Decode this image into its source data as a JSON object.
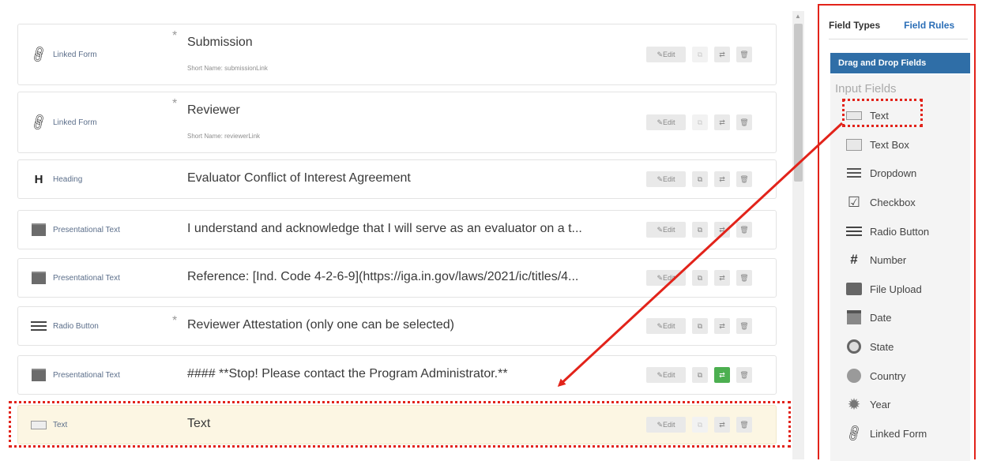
{
  "rows": [
    {
      "type_label": "Linked Form",
      "icon": "link-icon",
      "required": "*",
      "title": "Submission",
      "short_name": "Short Name: submissionLink",
      "edit": "Edit"
    },
    {
      "type_label": "Linked Form",
      "icon": "link-icon",
      "required": "*",
      "title": "Reviewer",
      "short_name": "Short Name: reviewerLink",
      "edit": "Edit"
    },
    {
      "type_label": "Heading",
      "icon": "heading-icon",
      "glyph": "H",
      "title": "Evaluator Conflict of Interest Agreement",
      "edit": "Edit"
    },
    {
      "type_label": "Presentational Text",
      "icon": "presentational-text-icon",
      "title": "I understand and acknowledge that I will serve as an evaluator on a t...",
      "edit": "Edit"
    },
    {
      "type_label": "Presentational Text",
      "icon": "presentational-text-icon",
      "title": "Reference: [Ind. Code 4-2-6-9](https://iga.in.gov/laws/2021/ic/titles/4...",
      "edit": "Edit"
    },
    {
      "type_label": "Radio Button",
      "icon": "radio-button-icon",
      "required": "*",
      "title": "Reviewer Attestation (only one can be selected)",
      "edit": "Edit"
    },
    {
      "type_label": "Presentational Text",
      "icon": "presentational-text-icon",
      "title": "#### **Stop!  Please contact the Program Administrator.**",
      "edit": "Edit"
    },
    {
      "type_label": "Text",
      "icon": "text-field-icon",
      "title": "Text",
      "edit": "Edit"
    }
  ],
  "panel": {
    "tabs": [
      "Field Types",
      "Field Rules"
    ],
    "header": "Drag and Drop Fields",
    "section": "Input Fields",
    "items": [
      {
        "label": "Text",
        "icon": "text-field-icon"
      },
      {
        "label": "Text Box",
        "icon": "text-box-icon"
      },
      {
        "label": "Dropdown",
        "icon": "dropdown-icon"
      },
      {
        "label": "Checkbox",
        "icon": "checkbox-icon"
      },
      {
        "label": "Radio Button",
        "icon": "radio-button-icon"
      },
      {
        "label": "Number",
        "icon": "number-icon",
        "glyph": "#"
      },
      {
        "label": "File Upload",
        "icon": "file-upload-icon"
      },
      {
        "label": "Date",
        "icon": "date-icon"
      },
      {
        "label": "State",
        "icon": "state-icon"
      },
      {
        "label": "Country",
        "icon": "country-icon"
      },
      {
        "label": "Year",
        "icon": "year-icon"
      },
      {
        "label": "Linked Form",
        "icon": "link-icon"
      }
    ]
  },
  "colors": {
    "annotation": "#e2231a",
    "header": "#2f6ea7",
    "highlight": "#fcf6e3",
    "active_button": "#4caf50"
  }
}
